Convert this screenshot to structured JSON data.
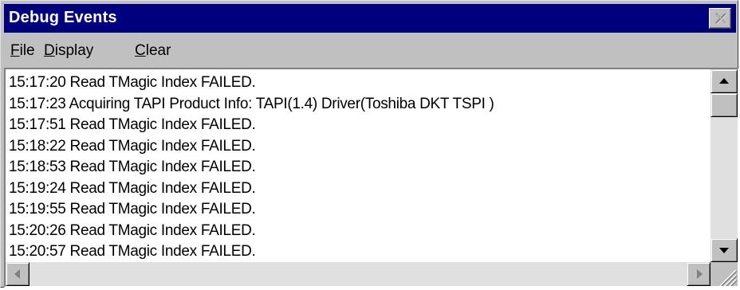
{
  "window": {
    "title": "Debug Events"
  },
  "menu": {
    "items": [
      {
        "accel": "F",
        "rest": "ile"
      },
      {
        "accel": "D",
        "rest": "isplay"
      },
      {
        "accel": "C",
        "rest": "lear"
      }
    ]
  },
  "log": {
    "lines": [
      "15:17:20 Read TMagic Index FAILED.",
      "15:17:23 Acquiring TAPI Product Info: TAPI(1.4) Driver(Toshiba DKT TSPI )",
      "15:17:51 Read TMagic Index FAILED.",
      "15:18:22 Read TMagic Index FAILED.",
      "15:18:53 Read TMagic Index FAILED.",
      "15:19:24 Read TMagic Index FAILED.",
      "15:19:55 Read TMagic Index FAILED.",
      "15:20:26 Read TMagic Index FAILED.",
      "15:20:57 Read TMagic Index FAILED."
    ]
  },
  "icons": {
    "close": "close-icon",
    "scroll_up": "arrow-up-icon",
    "scroll_down": "arrow-down-icon",
    "scroll_left": "arrow-left-icon",
    "scroll_right": "arrow-right-icon",
    "size_grip": "size-grip-icon"
  },
  "colors": {
    "titlebar": "#00007f",
    "face": "#c0c0c0",
    "log_bg": "#ffffff"
  }
}
